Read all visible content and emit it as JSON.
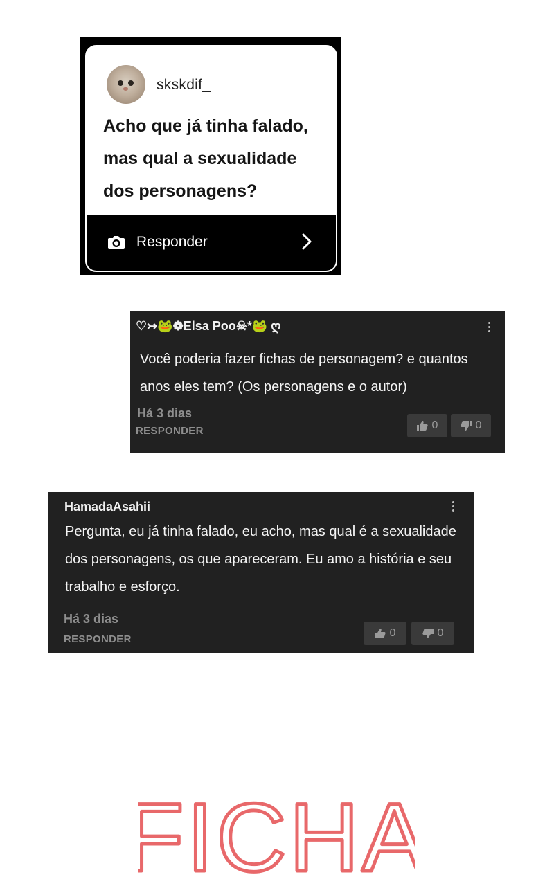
{
  "question_card": {
    "username": "skskdif_",
    "question": "Acho que já tinha falado, mas qual a sexualidade dos personagens?",
    "reply_label": "Responder",
    "icons": {
      "camera": "camera-icon",
      "chevron": "chevron-right-icon",
      "avatar": "cat-avatar"
    }
  },
  "comments": [
    {
      "author": "♡↣🐸❁Elsa Poo☠︎*🐸 ღ",
      "text": "Você poderia fazer fichas de personagem? e quantos anos eles tem? (Os personagens e o autor)",
      "time": "Há 3 dias",
      "reply": "RESPONDER",
      "likes": "0",
      "dislikes": "0"
    },
    {
      "author": "HamadaAsahii",
      "text": "Pergunta, eu já tinha falado, eu acho, mas qual é a sexualidade dos personagens, os que apareceram. Eu amo a história e seu trabalho e esforço.",
      "time": "Há 3 dias",
      "reply": "RESPONDER",
      "likes": "0",
      "dislikes": "0"
    }
  ],
  "title_art": {
    "text": "FICHA",
    "color": "#e8686a"
  },
  "colors": {
    "comment_bg": "#212121",
    "card_bg": "#000000",
    "muted": "#8e8e8e"
  }
}
